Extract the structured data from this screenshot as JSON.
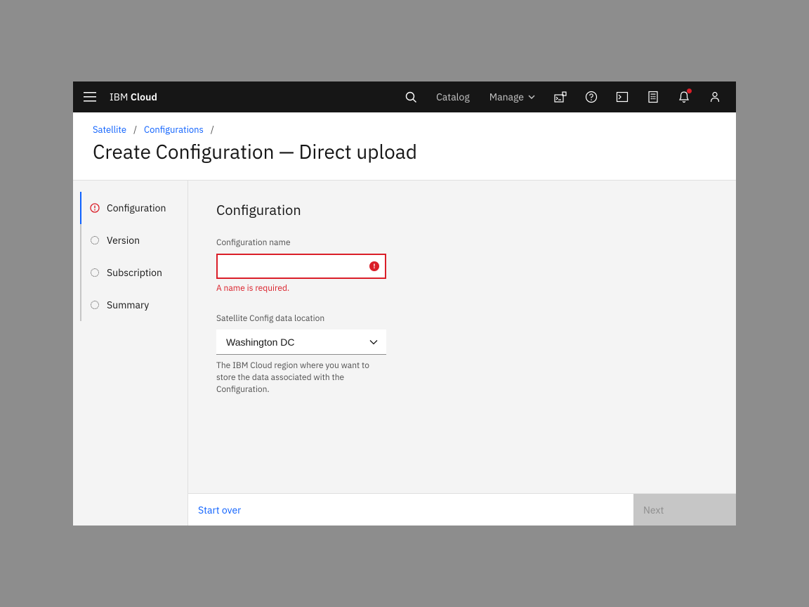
{
  "topbar": {
    "brand_prefix": "IBM ",
    "brand_bold": "Cloud",
    "catalog": "Catalog",
    "manage": "Manage"
  },
  "breadcrumbs": {
    "item1": "Satellite",
    "item2": "Configurations"
  },
  "page_title": "Create Configuration — Direct upload",
  "steps": {
    "configuration": "Configuration",
    "version": "Version",
    "subscription": "Subscription",
    "summary": "Summary"
  },
  "form": {
    "section_title": "Configuration",
    "name_label": "Configuration name",
    "name_value": "",
    "name_error": "A name is required.",
    "location_label": "Satellite Config data location",
    "location_value": "Washington DC",
    "location_helper": "The IBM Cloud region where you want to store the data associated with the Configuration."
  },
  "footer": {
    "start_over": "Start over",
    "next": "Next"
  }
}
